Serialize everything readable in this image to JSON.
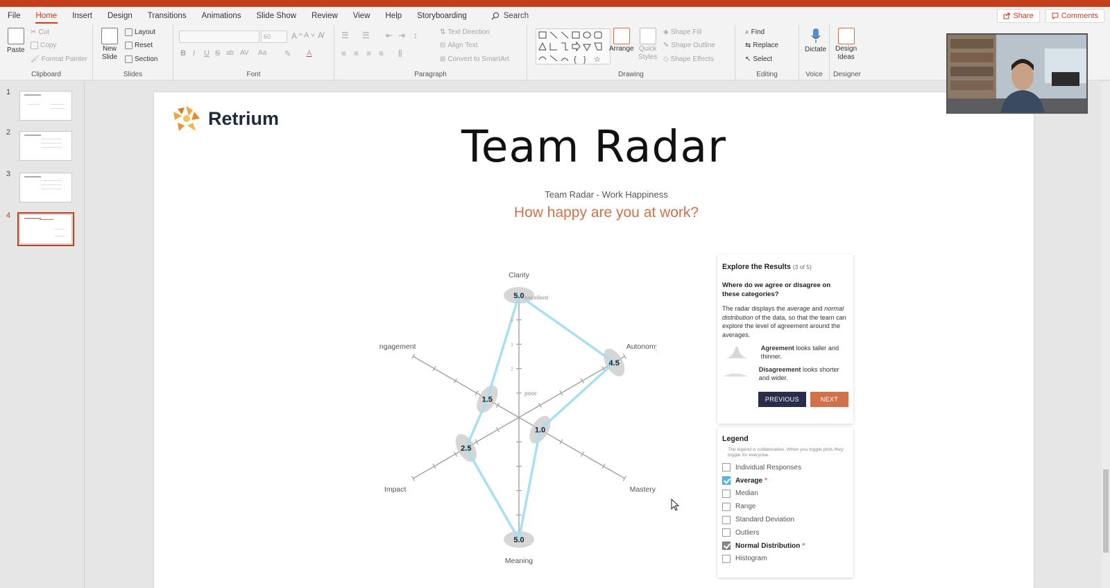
{
  "ribbon_tabs": [
    "File",
    "Home",
    "Insert",
    "Design",
    "Transitions",
    "Animations",
    "Slide Show",
    "Review",
    "View",
    "Help",
    "Storyboarding"
  ],
  "active_tab": "Home",
  "search_label": "Search",
  "share_label": "Share",
  "comments_label": "Comments",
  "ribbon": {
    "clipboard": {
      "paste": "Paste",
      "cut": "Cut",
      "copy": "Copy",
      "format_painter": "Format Painter",
      "label": "Clipboard"
    },
    "slides": {
      "new_slide_1": "New",
      "new_slide_2": "Slide",
      "layout": "Layout",
      "reset": "Reset",
      "section": "Section",
      "label": "Slides"
    },
    "font": {
      "size": "60",
      "label": "Font"
    },
    "paragraph": {
      "text_direction": "Text Direction",
      "align_text": "Align Text",
      "convert_smartart": "Convert to SmartArt",
      "label": "Paragraph"
    },
    "drawing": {
      "arrange": "Arrange",
      "quick_styles_1": "Quick",
      "quick_styles_2": "Styles",
      "shape_fill": "Shape Fill",
      "shape_outline": "Shape Outline",
      "shape_effects": "Shape Effects",
      "label": "Drawing"
    },
    "editing": {
      "find": "Find",
      "replace": "Replace",
      "select": "Select",
      "label": "Editing"
    },
    "voice": {
      "dictate": "Dictate",
      "label": "Voice"
    },
    "designer": {
      "design_ideas_1": "Design",
      "design_ideas_2": "Ideas",
      "label": "Designer"
    }
  },
  "slide_numbers": [
    "1",
    "2",
    "3",
    "4"
  ],
  "active_slide": 4,
  "slide": {
    "logo_text": "Retrium",
    "title": "Team Radar",
    "subtitle": "Team Radar - Work Happiness",
    "question": "How happy are you at work?"
  },
  "radar": {
    "axes": [
      {
        "name": "Clarity",
        "value": 5.0,
        "label": "5.0"
      },
      {
        "name": "Autonomy",
        "value": 4.5,
        "label": "4.5"
      },
      {
        "name": "Mastery",
        "value": 1.0,
        "label": "1.0"
      },
      {
        "name": "Meaning",
        "value": 5.0,
        "label": "5.0"
      },
      {
        "name": "Impact",
        "value": 2.5,
        "label": "2.5"
      },
      {
        "name": "Engagement",
        "value": 1.5,
        "label": "1.5"
      }
    ],
    "max": 5,
    "scale_labels": {
      "top": "excellent",
      "bottom": "poor"
    },
    "tick_numbers": [
      "2",
      "3",
      "4"
    ],
    "line_color": "#a8dff2",
    "axis_color": "#a0a0a0"
  },
  "explore": {
    "title": "Explore the Results",
    "count": "(3 of 5)",
    "question": "Where do we agree or disagree on these categories?",
    "p_1": "The radar displays the ",
    "p_em1": "average",
    "p_2": " and ",
    "p_em2": "normal distribution",
    "p_3": " of the data, so that the team can explore the level of agreement around the averages.",
    "agreement_bold": "Agreement",
    "agreement_text": " looks taller and thinner.",
    "disagreement_bold": "Disagreement",
    "disagreement_text": " looks shorter and wider.",
    "previous": "PREVIOUS",
    "next": "NEXT"
  },
  "legend": {
    "title": "Legend",
    "note": "The legend is collaborative. When you toggle plots they toggle for everyone.",
    "items": [
      {
        "label": "Individual Responses"
      },
      {
        "label": "Average"
      },
      {
        "label": "Median"
      },
      {
        "label": "Range"
      },
      {
        "label": "Standard Deviation"
      },
      {
        "label": "Outliers"
      },
      {
        "label": "Normal Distribution"
      },
      {
        "label": "Histogram"
      }
    ],
    "star": "*"
  },
  "colors": {
    "accent": "#c43e1c",
    "retrium_orange": "#d0714a",
    "retrium_navy": "#2a2c4a",
    "average_line": "#a8dff2"
  }
}
